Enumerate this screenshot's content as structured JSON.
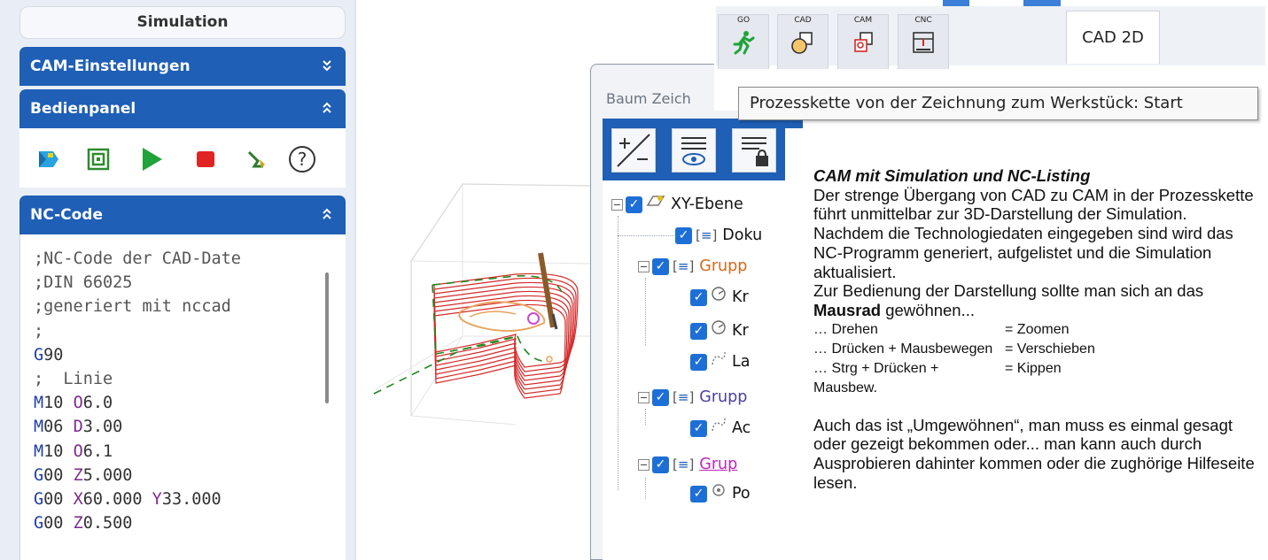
{
  "left_panel": {
    "title": "Simulation",
    "cam_settings": {
      "label": "CAM-Einstellungen",
      "chevron": "»"
    },
    "operator_panel": {
      "label": "Bedienpanel",
      "chevron": "«"
    },
    "nc_code": {
      "label": "NC-Code",
      "chevron": "«",
      "lines": [
        ";NC-Code der CAD-Date",
        ";DIN 66025",
        ";generiert mit nccad",
        ";",
        "G90",
        ";  Linie",
        "M10 O6.0",
        "M06 D3.00",
        "M10 O6.1",
        "G00 Z5.000",
        "G00 X60.000 Y33.000",
        "G00 Z0.500"
      ]
    },
    "toolbar_icons": [
      "workpiece-icon",
      "layers-icon",
      "play-icon",
      "stop-icon",
      "tool-path-icon",
      "help-icon"
    ]
  },
  "tree": {
    "title": "Baum Zeich",
    "rows": [
      {
        "label": "XY-Ebene",
        "color": "#111111"
      },
      {
        "label": "Doku",
        "color": "#111111"
      },
      {
        "label": "Grupp",
        "color": "#d2691e"
      },
      {
        "label": "Kr",
        "color": "#111111"
      },
      {
        "label": "Kr",
        "color": "#111111"
      },
      {
        "label": "La",
        "color": "#111111"
      },
      {
        "label": "Grupp",
        "color": "#4b3fa0"
      },
      {
        "label": "Ac",
        "color": "#111111"
      },
      {
        "label": "Grup",
        "color": "#c026b8"
      },
      {
        "label": "Po",
        "color": "#111111"
      }
    ]
  },
  "tabs": {
    "mini": [
      {
        "label": "GO",
        "icon": "run-icon"
      },
      {
        "label": "CAD",
        "icon": "cad-shapes-icon"
      },
      {
        "label": "CAM",
        "icon": "cam-shapes-icon"
      },
      {
        "label": "CNC",
        "icon": "cnc-machine-icon"
      }
    ],
    "main": "CAD 2D",
    "tooltip": "Prozesskette von der Zeichnung zum Werkstück: Start"
  },
  "description": {
    "title": "CAM mit Simulation und NC-Listing",
    "p1": "Der strenge Übergang von CAD zu CAM in der Prozesskette führt unmittelbar zur 3D-Darstellung der Simulation.",
    "p2": "Nachdem die Technologiedaten eingegeben sind wird das NC-Programm generiert, aufgelistet und die Simulation aktualisiert.",
    "p3_before": "Zur Bedienung der Darstellung sollte man sich an das ",
    "p3_bold": "Mausrad",
    "p3_after": " gewöhnen...",
    "actions": [
      {
        "left": "… Drehen",
        "right": "= Zoomen"
      },
      {
        "left": "… Drücken + Mausbewegen",
        "right": "= Verschieben"
      },
      {
        "left": "… Strg + Drücken + Mausbew.",
        "right": "= Kippen"
      }
    ],
    "p4": "Auch das ist „Umgewöhnen“, man muss es einmal gesagt oder gezeigt bekommen oder... man kann auch durch Ausprobieren dahinter kommen oder die zughörige Hilfeseite lesen."
  }
}
